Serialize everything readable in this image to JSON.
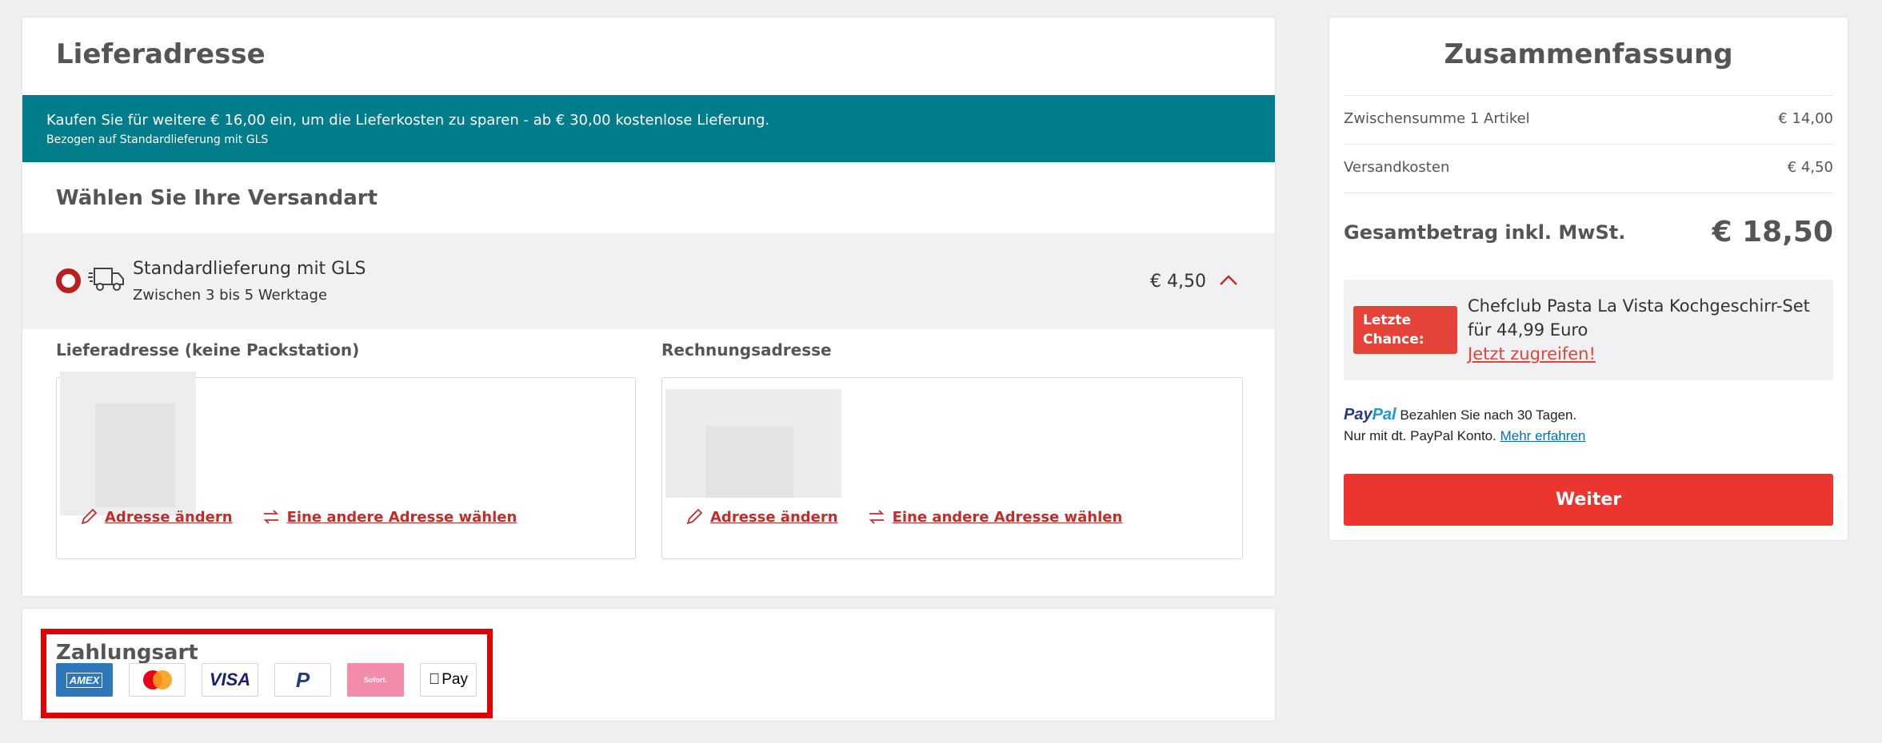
{
  "delivery": {
    "title": "Lieferadresse",
    "promo_line1": "Kaufen Sie für weitere € 16,00 ein, um die Lieferkosten zu sparen - ab € 30,00 kostenlose Lieferung.",
    "promo_line2": "Bezogen auf Standardlieferung mit GLS",
    "shipping_title": "Wählen Sie Ihre Versandart",
    "option": {
      "name": "Standardlieferung mit GLS",
      "time": "Zwischen 3 bis 5 Werktage",
      "price": "€ 4,50",
      "icon": "truck-icon"
    },
    "shipping_address_label": "Lieferadresse (keine Packstation)",
    "billing_address_label": "Rechnungsadresse",
    "edit_address": "Adresse ändern",
    "other_address": "Eine andere Adresse wählen"
  },
  "payment": {
    "title": "Zahlungsart",
    "methods": [
      "AMEX",
      "Mastercard",
      "VISA",
      "PayPal",
      "Sofort.",
      "Pay"
    ]
  },
  "summary": {
    "title": "Zusammenfassung",
    "subtotal_label": "Zwischensumme 1 Artikel",
    "subtotal_value": "€ 14,00",
    "shipping_label": "Versandkosten",
    "shipping_value": "€ 4,50",
    "total_label": "Gesamtbetrag inkl. MwSt.",
    "total_value": "€ 18,50",
    "last_chance_badge": "Letzte Chance:",
    "last_chance_text": "Chefclub Pasta La Vista Kochgeschirr-Set für 44,99 Euro",
    "last_chance_link": "Jetzt zugreifen!",
    "paypal_brand_1": "Pay",
    "paypal_brand_2": "Pal",
    "paypal_text1": "Bezahlen Sie nach 30 Tagen.",
    "paypal_text2": "Nur mit dt. PayPal Konto.",
    "paypal_link": "Mehr erfahren",
    "continue_button": "Weiter"
  },
  "colors": {
    "accent_red": "#ed3530",
    "teal_banner": "#007c8a",
    "badge_red": "#e4433a",
    "highlight_box": "#e20000"
  }
}
